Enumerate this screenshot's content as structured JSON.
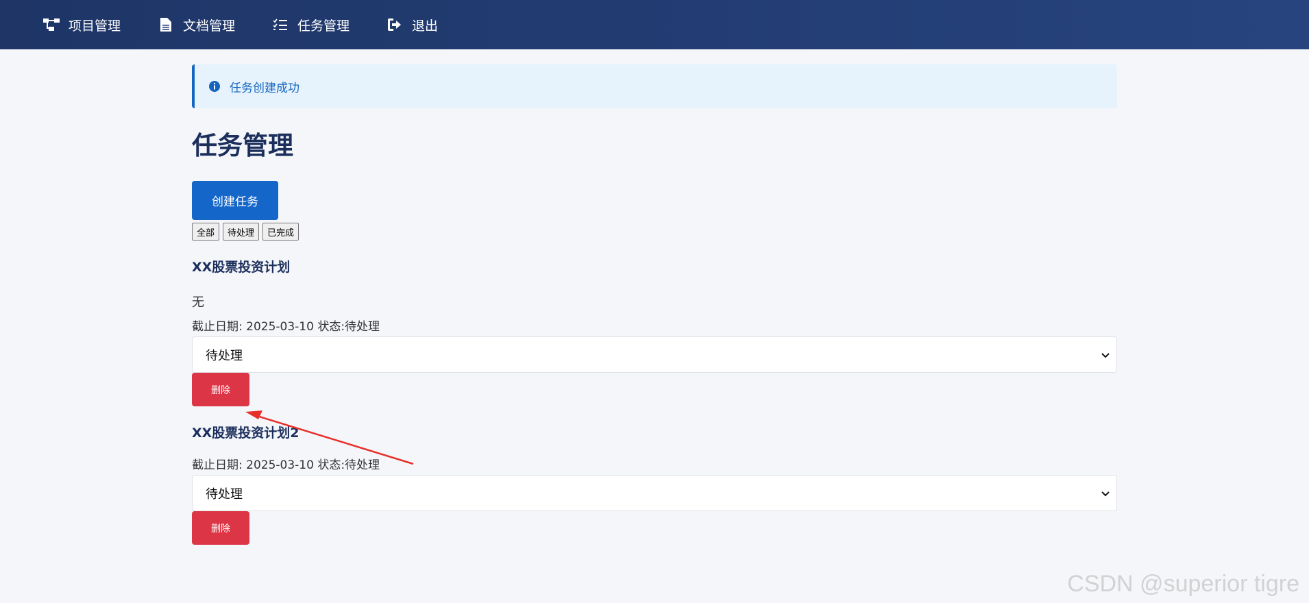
{
  "nav": {
    "items": [
      {
        "label": "项目管理",
        "icon": "project-tree-icon"
      },
      {
        "label": "文档管理",
        "icon": "file-icon"
      },
      {
        "label": "任务管理",
        "icon": "task-list-icon"
      },
      {
        "label": "退出",
        "icon": "logout-icon"
      }
    ]
  },
  "alert": {
    "text": "任务创建成功",
    "icon": "info-circle-icon"
  },
  "page": {
    "title": "任务管理",
    "create_label": "创建任务"
  },
  "filters": [
    "全部",
    "待处理",
    "已完成"
  ],
  "tasks": [
    {
      "title": "XX股票投资计划",
      "description": "无",
      "meta": "截止日期: 2025-03-10 状态:待处理",
      "status_value": "待处理",
      "delete_label": "删除"
    },
    {
      "title": "XX股票投资计划2",
      "description": "",
      "meta": "截止日期: 2025-03-10 状态:待处理",
      "status_value": "待处理",
      "delete_label": "删除"
    }
  ],
  "watermark": "CSDN @superior tigre",
  "colors": {
    "nav_bg": "#1e3566",
    "primary": "#1566c9",
    "danger": "#dc3545",
    "alert_bg": "#e6f3fd",
    "annotation_arrow": "#e8302a"
  }
}
